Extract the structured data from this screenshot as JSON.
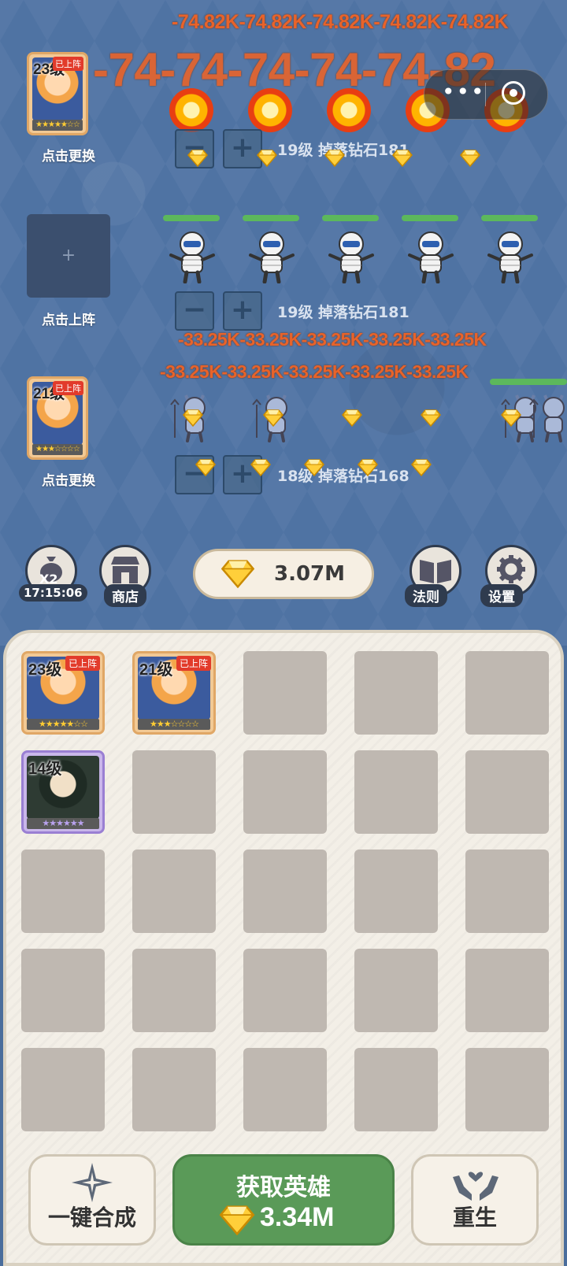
{
  "battle": {
    "damage_top_row": "-74.82K-74.82K-74.82K-74.82K-74.82K",
    "damage_top_big": "-74-74-74-74-74-82",
    "damage_mid_row1": "-33.25K-33.25K-33.25K-33.25K-33.25K",
    "damage_mid_row2": "-33.25K-33.25K-33.25K-33.25K-33.25K",
    "lanes": [
      {
        "info": "19级 掉落钻石181"
      },
      {
        "info": "19级 掉落钻石181"
      },
      {
        "info": "18级 掉落钻石168"
      }
    ],
    "minus": "−",
    "plus": "+"
  },
  "slots": [
    {
      "level": "23级",
      "tag": "已上阵",
      "stars": "★★★★★☆☆",
      "label": "点击更换"
    },
    {
      "empty_symbol": "+",
      "label": "点击上阵"
    },
    {
      "level": "21级",
      "tag": "已上阵",
      "stars": "★★★☆☆☆☆",
      "label": "点击更换"
    }
  ],
  "toolbar": {
    "x2_badge": "X2",
    "timer": "17:15:06",
    "shop_label": "商店",
    "gems": "3.07M",
    "rules_label": "法则",
    "settings_label": "设置"
  },
  "inventory": {
    "cards": [
      {
        "level": "23级",
        "tag": "已上阵",
        "stars": "★★★★★☆☆"
      },
      {
        "level": "21级",
        "tag": "已上阵",
        "stars": "★★★☆☆☆☆"
      },
      {
        "level": "14级",
        "stars": "★★★★★★"
      }
    ]
  },
  "actions": {
    "merge_label": "一键合成",
    "get_hero_label": "获取英雄",
    "get_hero_cost": "3.34M",
    "rebirth_label": "重生"
  },
  "icons": {
    "gem": "diamond-icon",
    "bag": "money-bag-icon",
    "shop": "shop-icon",
    "rules": "book-icon",
    "settings": "gear-icon",
    "sparkle": "sparkle-icon",
    "hands": "heart-hands-icon"
  },
  "colors": {
    "damage": "#e8632a",
    "main_button": "#5a9a58",
    "gem": "#ffc93c"
  }
}
